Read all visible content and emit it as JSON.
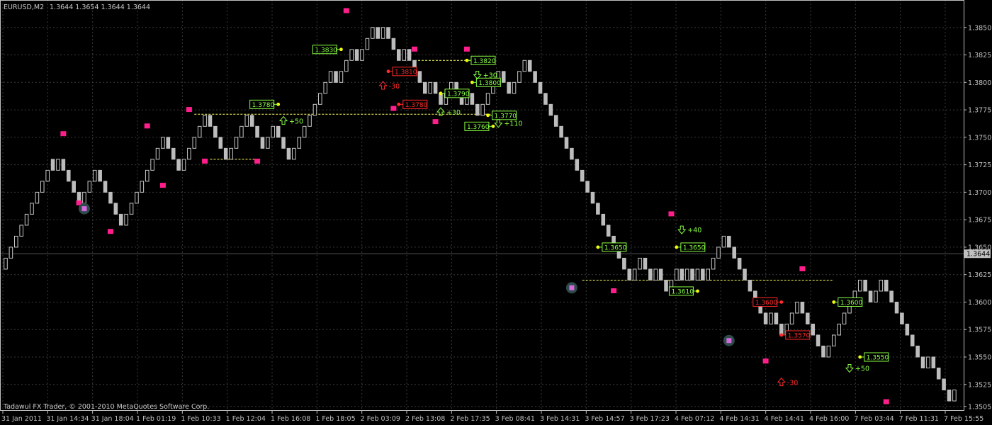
{
  "header": {
    "symbol": "EURUSD,M2",
    "ohlc": "1.3644 1.3654 1.3644 1.3644"
  },
  "footer": {
    "copyright": "Tadawul FX Trader, © 2001-2010 MetaQuotes Software Corp."
  },
  "colors": {
    "background": "#000000",
    "grid": "#3a3a3a",
    "axis": "#c0c0c0",
    "bull": "#000000",
    "bear": "#bdbdbd",
    "bar_outline": "#c8c8c8",
    "level_line": "#ffff66",
    "marker_pink": "#ff1e8c",
    "signal_green": "#88ff44",
    "signal_red": "#ff2a2a",
    "point_yellow": "#ffff00",
    "current_price_bg": "#c0c0c0"
  },
  "chart_data": {
    "type": "bar",
    "title": "",
    "ylim": [
      1.35,
      1.3875
    ],
    "yticks": [
      1.385,
      1.3825,
      1.38,
      1.3775,
      1.375,
      1.3725,
      1.37,
      1.3675,
      1.365,
      1.3625,
      1.36,
      1.3575,
      1.355,
      1.3525,
      1.3505
    ],
    "ytick_labels": [
      "1.3850",
      "1.3825",
      "1.3800",
      "1.3775",
      "1.3750",
      "1.3725",
      "1.3700",
      "1.3675",
      "1.3650",
      "1.3625",
      "1.3600",
      "1.3575",
      "1.3550",
      "1.3525",
      "1.3505"
    ],
    "current_price": "1.3644",
    "xticks": [
      "31 Jan 2011",
      "31 Jan 14:34",
      "31 Jan 18:04",
      "1 Feb 01:19",
      "1 Feb 10:33",
      "1 Feb 12:04",
      "1 Feb 16:08",
      "1 Feb 18:05",
      "2 Feb 03:09",
      "2 Feb 13:08",
      "2 Feb 17:35",
      "3 Feb 08:41",
      "3 Feb 14:31",
      "3 Feb 14:57",
      "3 Feb 17:23",
      "4 Feb 07:12",
      "4 Feb 14:31",
      "4 Feb 14:41",
      "4 Feb 16:00",
      "7 Feb 03:44",
      "7 Feb 11:31",
      "7 Feb 15:55"
    ],
    "bricks": [
      1.364,
      1.365,
      1.366,
      1.367,
      1.368,
      1.369,
      1.37,
      1.371,
      1.372,
      1.372,
      1.373,
      1.372,
      1.371,
      1.37,
      1.369,
      1.37,
      1.371,
      1.372,
      1.371,
      1.37,
      1.369,
      1.368,
      1.367,
      1.368,
      1.369,
      1.37,
      1.371,
      1.372,
      1.373,
      1.374,
      1.375,
      1.374,
      1.373,
      1.372,
      1.373,
      1.374,
      1.375,
      1.376,
      1.377,
      1.376,
      1.375,
      1.374,
      1.373,
      1.374,
      1.375,
      1.376,
      1.377,
      1.376,
      1.375,
      1.374,
      1.375,
      1.376,
      1.375,
      1.374,
      1.373,
      1.374,
      1.375,
      1.376,
      1.377,
      1.378,
      1.379,
      1.38,
      1.381,
      1.38,
      1.381,
      1.382,
      1.383,
      1.382,
      1.383,
      1.384,
      1.385,
      1.384,
      1.385,
      1.384,
      1.383,
      1.382,
      1.383,
      1.382,
      1.381,
      1.38,
      1.379,
      1.38,
      1.379,
      1.378,
      1.379,
      1.38,
      1.379,
      1.378,
      1.379,
      1.378,
      1.377,
      1.378,
      1.379,
      1.38,
      1.381,
      1.38,
      1.379,
      1.38,
      1.381,
      1.382,
      1.381,
      1.38,
      1.379,
      1.378,
      1.377,
      1.376,
      1.375,
      1.374,
      1.373,
      1.372,
      1.371,
      1.37,
      1.369,
      1.368,
      1.367,
      1.366,
      1.365,
      1.364,
      1.363,
      1.362,
      1.363,
      1.364,
      1.363,
      1.362,
      1.363,
      1.362,
      1.361,
      1.362,
      1.363,
      1.362,
      1.363,
      1.362,
      1.363,
      1.362,
      1.363,
      1.364,
      1.365,
      1.366,
      1.365,
      1.364,
      1.363,
      1.362,
      1.361,
      1.36,
      1.359,
      1.358,
      1.359,
      1.358,
      1.357,
      1.358,
      1.359,
      1.36,
      1.359,
      1.358,
      1.357,
      1.356,
      1.355,
      1.356,
      1.357,
      1.358,
      1.359,
      1.36,
      1.361,
      1.362,
      1.361,
      1.36,
      1.361,
      1.362,
      1.361,
      1.36,
      1.359,
      1.358,
      1.357,
      1.356,
      1.355,
      1.354,
      1.355,
      1.354,
      1.353,
      1.352,
      1.351,
      1.352
    ],
    "level_lines": [
      {
        "from": 36,
        "to": 97,
        "price": 1.3771
      },
      {
        "from": 39,
        "to": 48,
        "price": 1.373
      },
      {
        "from": 78,
        "to": 89,
        "price": 1.382
      },
      {
        "from": 110,
        "to": 158,
        "price": 1.362
      }
    ],
    "price_labels": [
      {
        "text": "1.3780",
        "bar": 52,
        "price": 1.378,
        "color": "green",
        "side": "left"
      },
      {
        "text": "1.3830",
        "bar": 64,
        "price": 1.383,
        "color": "green",
        "side": "left"
      },
      {
        "text": "1.3810",
        "bar": 73,
        "price": 1.381,
        "color": "red",
        "side": "right"
      },
      {
        "text": "1.3780",
        "bar": 75,
        "price": 1.378,
        "color": "red",
        "side": "right"
      },
      {
        "text": "1.3790",
        "bar": 83,
        "price": 1.379,
        "color": "green",
        "side": "right"
      },
      {
        "text": "1.3820",
        "bar": 88,
        "price": 1.382,
        "color": "green",
        "side": "right"
      },
      {
        "text": "1.3800",
        "bar": 89,
        "price": 1.38,
        "color": "green",
        "side": "right"
      },
      {
        "text": "1.3770",
        "bar": 92,
        "price": 1.377,
        "color": "green",
        "side": "right"
      },
      {
        "text": "1.3760",
        "bar": 93,
        "price": 1.376,
        "color": "green",
        "side": "left"
      },
      {
        "text": "1.3650",
        "bar": 113,
        "price": 1.365,
        "color": "green",
        "side": "right"
      },
      {
        "text": "1.3650",
        "bar": 128,
        "price": 1.365,
        "color": "green",
        "side": "right"
      },
      {
        "text": "1.3610",
        "bar": 132,
        "price": 1.361,
        "color": "green",
        "side": "left"
      },
      {
        "text": "1.3600",
        "bar": 148,
        "price": 1.36,
        "color": "red",
        "side": "left"
      },
      {
        "text": "1.3570",
        "bar": 148,
        "price": 1.357,
        "color": "red",
        "side": "right"
      },
      {
        "text": "1.3600",
        "bar": 158,
        "price": 1.36,
        "color": "green",
        "side": "right"
      },
      {
        "text": "1.3550",
        "bar": 163,
        "price": 1.355,
        "color": "green",
        "side": "right"
      }
    ],
    "signals": [
      {
        "text": "+50",
        "bar": 53,
        "price": 1.3765,
        "color": "green",
        "dir": "up"
      },
      {
        "text": "-30",
        "bar": 72,
        "price": 1.3797,
        "color": "red",
        "dir": "up"
      },
      {
        "text": "+30",
        "bar": 83,
        "price": 1.3773,
        "color": "green",
        "dir": "up"
      },
      {
        "text": "+30",
        "bar": 90,
        "price": 1.3807,
        "color": "green",
        "dir": "down"
      },
      {
        "text": "+110",
        "bar": 94,
        "price": 1.3763,
        "color": "green",
        "dir": "down"
      },
      {
        "text": "+40",
        "bar": 129,
        "price": 1.3666,
        "color": "green",
        "dir": "down"
      },
      {
        "text": "-30",
        "bar": 148,
        "price": 1.3527,
        "color": "red",
        "dir": "up"
      },
      {
        "text": "+50",
        "bar": 161,
        "price": 1.354,
        "color": "green",
        "dir": "down"
      }
    ],
    "pink_markers": [
      {
        "bar": 11,
        "price": 1.3753
      },
      {
        "bar": 14,
        "price": 1.369
      },
      {
        "bar": 20,
        "price": 1.3664
      },
      {
        "bar": 27,
        "price": 1.376
      },
      {
        "bar": 30,
        "price": 1.3706
      },
      {
        "bar": 35,
        "price": 1.3775
      },
      {
        "bar": 38,
        "price": 1.3728
      },
      {
        "bar": 48,
        "price": 1.3728
      },
      {
        "bar": 65,
        "price": 1.3865
      },
      {
        "bar": 74,
        "price": 1.3776
      },
      {
        "bar": 78,
        "price": 1.383
      },
      {
        "bar": 82,
        "price": 1.3764
      },
      {
        "bar": 88,
        "price": 1.383
      },
      {
        "bar": 116,
        "price": 1.361
      },
      {
        "bar": 127,
        "price": 1.368
      },
      {
        "bar": 145,
        "price": 1.3546
      },
      {
        "bar": 152,
        "price": 1.363
      },
      {
        "bar": 168,
        "price": 1.3509
      }
    ],
    "circle_markers": [
      {
        "bar": 15,
        "price": 1.3685
      },
      {
        "bar": 108,
        "price": 1.3613
      },
      {
        "bar": 138,
        "price": 1.3565
      }
    ]
  }
}
